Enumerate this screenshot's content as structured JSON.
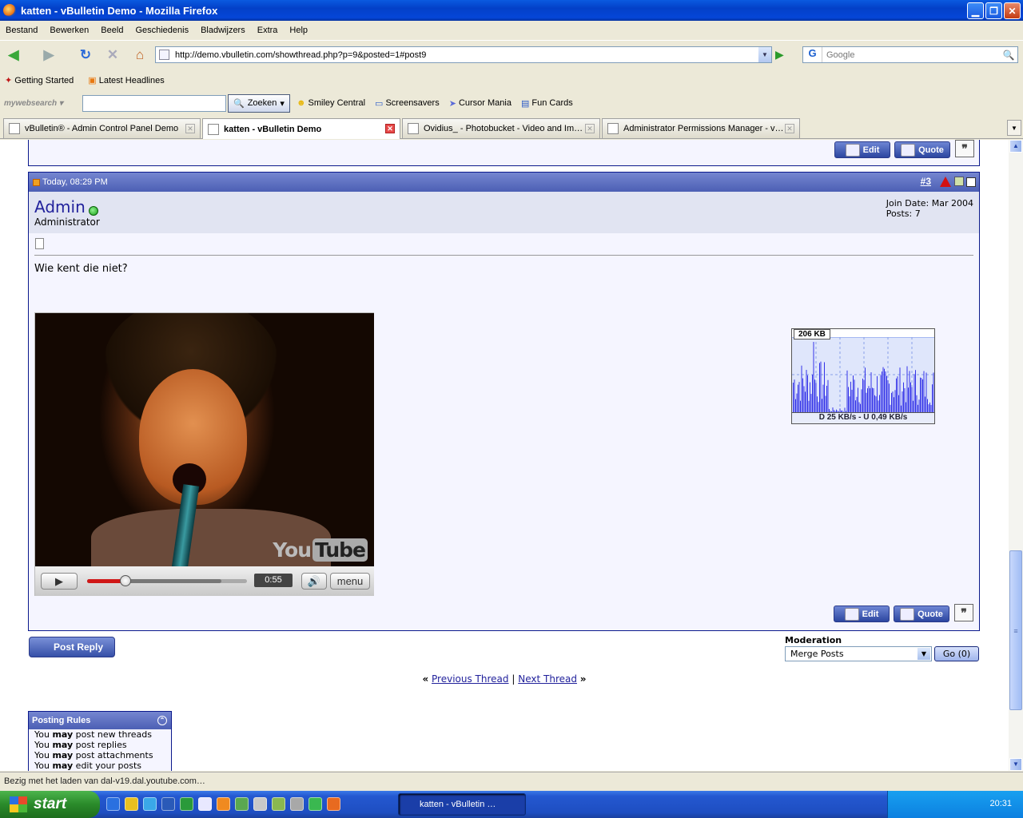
{
  "window": {
    "title": "katten - vBulletin Demo - Mozilla Firefox"
  },
  "menu": [
    "Bestand",
    "Bewerken",
    "Beeld",
    "Geschiedenis",
    "Bladwijzers",
    "Extra",
    "Help"
  ],
  "nav": {
    "url": "http://demo.vbulletin.com/showthread.php?p=9&posted=1#post9",
    "search_placeholder": "Google"
  },
  "bookmarks": [
    "Getting Started",
    "Latest Headlines"
  ],
  "mywebsearch": {
    "logo": "mywebsearch",
    "search_button": "Zoeken",
    "links": [
      "Smiley Central",
      "Screensavers",
      "Cursor Mania",
      "Fun Cards"
    ]
  },
  "tabs": [
    {
      "label": "vBulletin® - Admin Control Panel Demo",
      "active": false
    },
    {
      "label": "katten - vBulletin Demo",
      "active": true
    },
    {
      "label": "Ovidius_ - Photobucket - Video and Im…",
      "active": false
    },
    {
      "label": "Administrator Permissions Manager - v…",
      "active": false
    }
  ],
  "post": {
    "date": "Today, 08:29 PM",
    "number_prefix": "#",
    "number": "3",
    "username": "Admin",
    "usertitle": "Administrator",
    "join_date": "Join Date: Mar 2004",
    "posts": "Posts: 7",
    "message": "Wie kent die niet?",
    "edit_label": "Edit",
    "quote_label": "Quote"
  },
  "video": {
    "time": "0:55",
    "menu_label": "menu",
    "logo_you": "You",
    "logo_tube": "Tube",
    "played_fraction": 0.24,
    "loaded_fraction": 0.84
  },
  "netmonitor": {
    "peak": "206 KB",
    "rate": "D 25 KB/s - U 0,49 KB/s"
  },
  "actions": {
    "post_reply": "Post Reply"
  },
  "moderation": {
    "title": "Moderation",
    "selected": "Merge Posts",
    "go": "Go (0)"
  },
  "thread_nav": {
    "prev": "Previous Thread",
    "next": "Next Thread",
    "sep": "|",
    "left_arrows": "«",
    "right_arrows": "»"
  },
  "posting_rules": {
    "title": "Posting Rules",
    "lines": [
      {
        "pre": "You ",
        "bold": "may",
        "post": " post new threads"
      },
      {
        "pre": "You ",
        "bold": "may",
        "post": " post replies"
      },
      {
        "pre": "You ",
        "bold": "may",
        "post": " post attachments"
      },
      {
        "pre": "You ",
        "bold": "may",
        "post": " edit your posts"
      }
    ]
  },
  "status": "Bezig met het laden van dal-v19.dal.youtube.com…",
  "taskbar": {
    "start": "start",
    "item": "katten - vBulletin …",
    "clock": "20:31"
  }
}
